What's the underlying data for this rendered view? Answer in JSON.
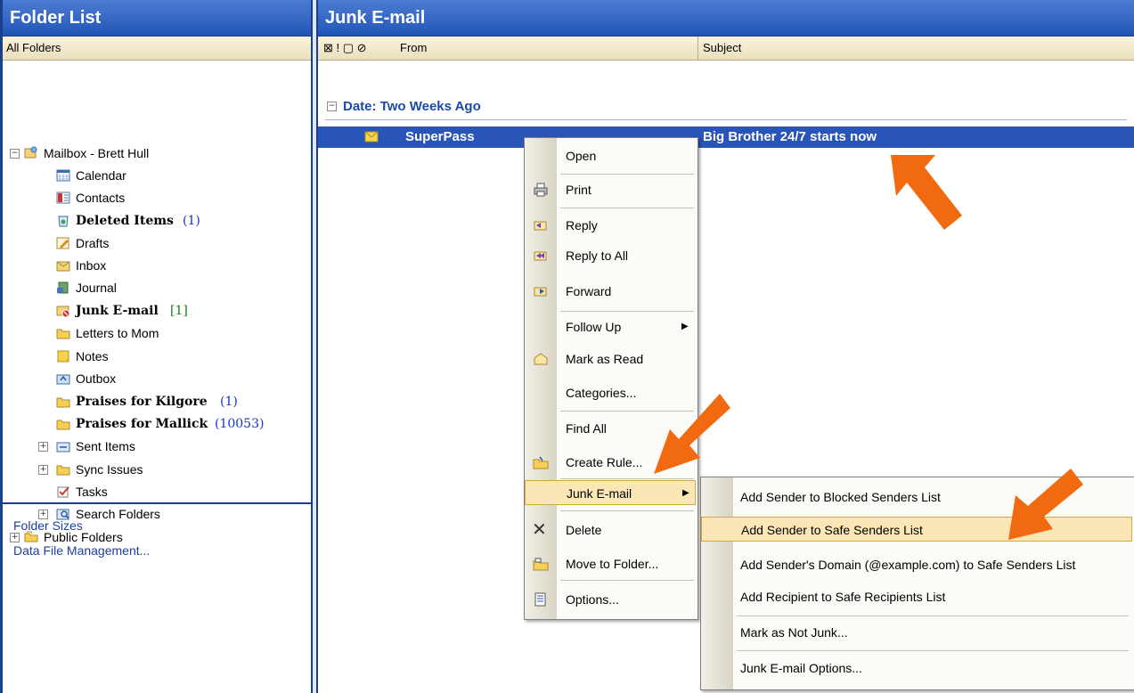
{
  "left_pane": {
    "title": "Folder List",
    "subheader": "All Folders",
    "tree": [
      {
        "label": "Mailbox - Brett Hull",
        "count": "",
        "icon": "mailbox-icon",
        "bold": false
      },
      {
        "label": "Calendar",
        "count": "",
        "icon": "calendar-icon",
        "bold": false
      },
      {
        "label": "Contacts",
        "count": "",
        "icon": "contacts-icon",
        "bold": false
      },
      {
        "label": "Deleted Items",
        "count": "(1)",
        "icon": "deleted-items-icon",
        "bold": true
      },
      {
        "label": "Drafts",
        "count": "",
        "icon": "drafts-icon",
        "bold": false
      },
      {
        "label": "Inbox",
        "count": "",
        "icon": "inbox-icon",
        "bold": false
      },
      {
        "label": "Journal",
        "count": "",
        "icon": "journal-icon",
        "bold": false
      },
      {
        "label": "Junk E-mail",
        "count": "[1]",
        "icon": "junk-email-icon",
        "bold": true
      },
      {
        "label": "Letters to Mom",
        "count": "",
        "icon": "folder-icon",
        "bold": false
      },
      {
        "label": "Notes",
        "count": "",
        "icon": "notes-icon",
        "bold": false
      },
      {
        "label": "Outbox",
        "count": "",
        "icon": "outbox-icon",
        "bold": false
      },
      {
        "label": "Praises for Kilgore",
        "count": "(1)",
        "icon": "folder-icon",
        "bold": true
      },
      {
        "label": "Praises for Mallick",
        "count": "(10053)",
        "icon": "folder-icon",
        "bold": true
      },
      {
        "label": "Sent Items",
        "count": "",
        "icon": "sent-items-icon",
        "bold": false
      },
      {
        "label": "Sync Issues",
        "count": "",
        "icon": "folder-icon",
        "bold": false
      },
      {
        "label": "Tasks",
        "count": "",
        "icon": "tasks-icon",
        "bold": false
      },
      {
        "label": "Search Folders",
        "count": "",
        "icon": "search-folders-icon",
        "bold": false
      },
      {
        "label": "Public Folders",
        "count": "",
        "icon": "public-folders-icon",
        "bold": false
      }
    ],
    "links": {
      "folder_sizes": "Folder Sizes",
      "data_file_management": "Data File Management..."
    }
  },
  "right_pane": {
    "title": "Junk E-mail",
    "columns": {
      "from": "From",
      "subject": "Subject"
    },
    "group_header": "Date: Two Weeks Ago",
    "message": {
      "from": "SuperPass",
      "subject": "Big Brother 24/7 starts now"
    }
  },
  "context_menu": {
    "open": "Open",
    "print": "Print",
    "reply": "Reply",
    "reply_all": "Reply to All",
    "forward": "Forward",
    "follow_up": "Follow Up",
    "mark_read": "Mark as Read",
    "categories": "Categories...",
    "find_all": "Find All",
    "create_rule": "Create Rule...",
    "junk_email": "Junk E-mail",
    "delete": "Delete",
    "move_to_folder": "Move to Folder...",
    "options": "Options..."
  },
  "junk_submenu": {
    "blocked": "Add Sender to Blocked Senders List",
    "safe": "Add Sender to Safe Senders List",
    "domain": "Add Sender's Domain (@example.com) to Safe Senders List",
    "recipient": "Add Recipient to Safe Recipients List",
    "not_junk": "Mark as Not Junk...",
    "options": "Junk E-mail Options..."
  },
  "colors": {
    "titlebar": "#2254b7",
    "selection": "#2a55b8",
    "annotation_arrow": "#f26a0f",
    "menu_highlight": "#fbe7b5"
  }
}
